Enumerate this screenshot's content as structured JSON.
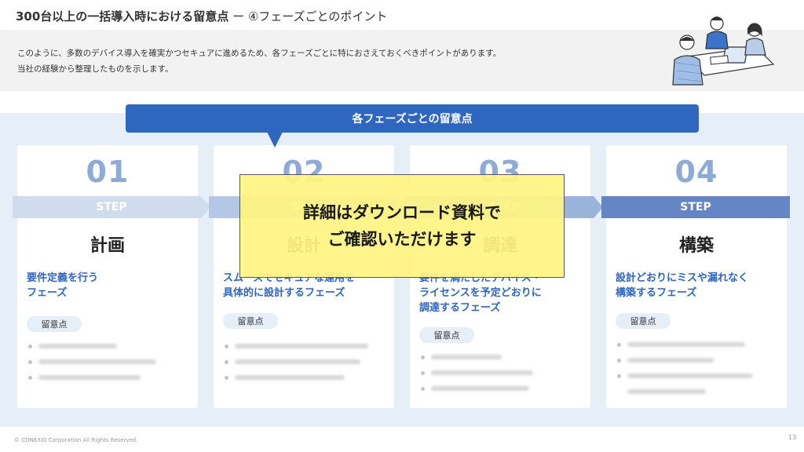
{
  "title": {
    "main": "300台以上の一括導入時における留意点",
    "sub": " ー ④フェーズごとのポイント"
  },
  "intro": {
    "line1": "このように、多数のデバイス導入を確実かつセキュアに進めるため、各フェーズごとに特におさえておくべきポイントがあります。",
    "line2": "当社の経験から整理したものを示します。"
  },
  "banner": "各フェーズごとの留意点",
  "steps": [
    {
      "num": "01",
      "label": "STEP",
      "name": "計画",
      "desc": "要件定義を行う\nフェーズ",
      "pill": "留意点"
    },
    {
      "num": "02",
      "label": "STEP",
      "name": "設計",
      "desc": "スムーズでセキュアな運用を\n具体的に設計するフェーズ",
      "pill": "留意点"
    },
    {
      "num": "03",
      "label": "STEP",
      "name": "調達",
      "desc": "要件を満たしたデバイス・\nライセンスを予定どおりに\n調達するフェーズ",
      "pill": "留意点"
    },
    {
      "num": "04",
      "label": "STEP",
      "name": "構築",
      "desc": "設計どおりにミスや漏れなく\n構築するフェーズ",
      "pill": "留意点"
    }
  ],
  "overlay": {
    "line1": "詳細はダウンロード資料で",
    "line2": "ご確認いただけます"
  },
  "footer": "© CONEXIO Corporation All Rights Reserved.",
  "page_number": "13",
  "colors": {
    "accent": "#2e66c0",
    "step_number": "#8eaad6",
    "overlay": "#fff482",
    "panel": "#e6eef8"
  },
  "icons": [
    "people-meeting-illustration"
  ]
}
